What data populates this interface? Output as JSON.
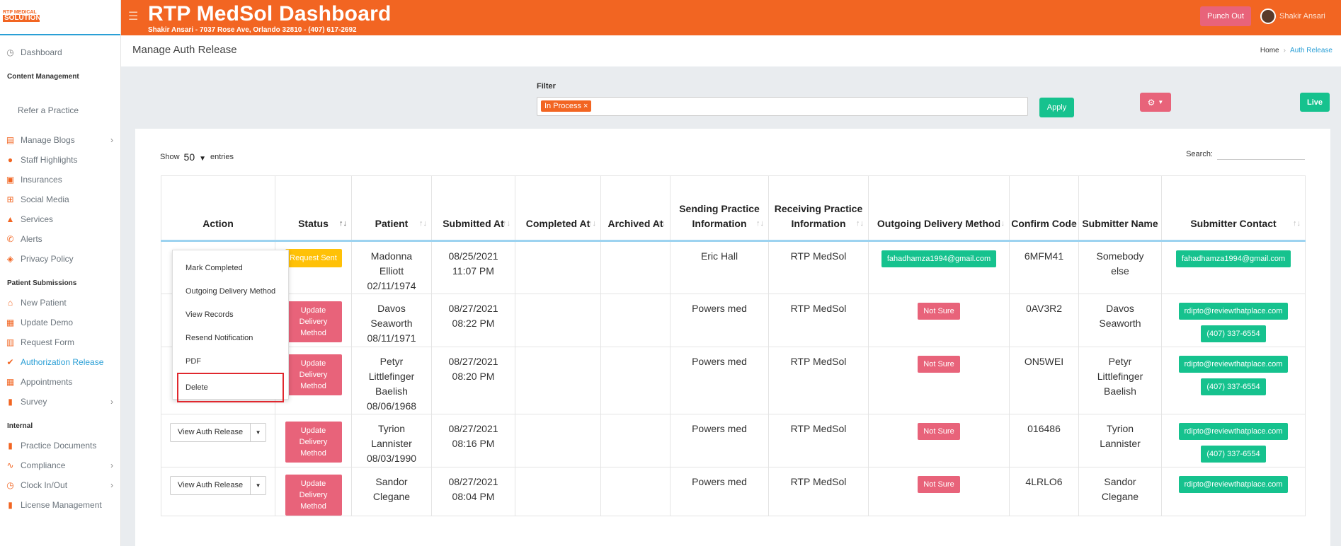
{
  "logo": {
    "top": "RTP MEDICAL",
    "bottom": "SOLUTION"
  },
  "header": {
    "title": "RTP MedSol Dashboard",
    "subtitle": "Shakir Ansari - 7037 Rose Ave, Orlando 32810 - (407) 617-2692",
    "punch_label": "Punch Out",
    "user_name": "Shakir Ansari"
  },
  "sidebar": {
    "dashboard": "Dashboard",
    "content_heading": "Content Management",
    "refer": "Refer a Practice",
    "content_items": [
      {
        "label": "Manage Blogs",
        "icon": "blog-icon",
        "chevron": true
      },
      {
        "label": "Staff Highlights",
        "icon": "user-icon"
      },
      {
        "label": "Insurances",
        "icon": "briefcase-icon"
      },
      {
        "label": "Social Media",
        "icon": "share-icon"
      },
      {
        "label": "Services",
        "icon": "service-icon"
      },
      {
        "label": "Alerts",
        "icon": "phone-icon"
      },
      {
        "label": "Privacy Policy",
        "icon": "shield-icon"
      }
    ],
    "patient_heading": "Patient Submissions",
    "patient_items": [
      {
        "label": "New Patient",
        "icon": "home-icon"
      },
      {
        "label": "Update Demo",
        "icon": "table-icon"
      },
      {
        "label": "Request Form",
        "icon": "form-icon"
      },
      {
        "label": "Authorization Release",
        "icon": "check-icon",
        "active": true
      },
      {
        "label": "Appointments",
        "icon": "calendar-icon"
      },
      {
        "label": "Survey",
        "icon": "chart-icon",
        "chevron": true
      }
    ],
    "internal_heading": "Internal",
    "internal_items": [
      {
        "label": "Practice Documents",
        "icon": "document-icon"
      },
      {
        "label": "Compliance",
        "icon": "wave-icon",
        "chevron": true
      },
      {
        "label": "Clock In/Out",
        "icon": "clock-icon",
        "chevron": true
      },
      {
        "label": "License Management",
        "icon": "license-icon"
      }
    ]
  },
  "page": {
    "title": "Manage Auth Release",
    "breadcrumb_home": "Home",
    "breadcrumb_current": "Auth Release"
  },
  "filter": {
    "label": "Filter",
    "tag": "In Process ×",
    "apply": "Apply",
    "live": "Live"
  },
  "table_controls": {
    "show": "Show",
    "entries_value": "50",
    "entries": "entries",
    "search": "Search:"
  },
  "columns": [
    "Action",
    "Status",
    "Patient",
    "Submitted At",
    "Completed At",
    "Archived At",
    "Sending Practice Information",
    "Receiving Practice Information",
    "Outgoing Delivery Method",
    "Confirm Code",
    "Submitter Name",
    "Submitter Contact"
  ],
  "rows": [
    {
      "action": "",
      "status": "Request Sent",
      "status_color": "#ffc107",
      "patient": "Madonna Elliott 02/11/1974",
      "submitted": "08/25/2021 11:07 PM",
      "sending": "Eric Hall",
      "receiving": "RTP MedSol",
      "outgoing": "fahadhamza1994@gmail.com",
      "outgoing_color": "#16c28e",
      "code": "6MFM41",
      "submitter": "Somebody else",
      "email": "fahadhamza1994@gmail.com",
      "phone": ""
    },
    {
      "action": "",
      "status": "Update Delivery Method",
      "status_color": "#e8637a",
      "patient": "Davos Seaworth 08/11/1971",
      "submitted": "08/27/2021 08:22 PM",
      "sending": "Powers med",
      "receiving": "RTP MedSol",
      "outgoing": "Not Sure",
      "outgoing_color": "#e8637a",
      "code": "0AV3R2",
      "submitter": "Davos Seaworth",
      "email": "rdipto@reviewthatplace.com",
      "phone": "(407) 337-6554"
    },
    {
      "action": "",
      "status": "Update Delivery Method",
      "status_color": "#e8637a",
      "patient": "Petyr Littlefinger Baelish 08/06/1968",
      "submitted": "08/27/2021 08:20 PM",
      "sending": "Powers med",
      "receiving": "RTP MedSol",
      "outgoing": "Not Sure",
      "outgoing_color": "#e8637a",
      "code": "ON5WEI",
      "submitter": "Petyr Littlefinger Baelish",
      "email": "rdipto@reviewthatplace.com",
      "phone": "(407) 337-6554"
    },
    {
      "action": "View Auth Release",
      "status": "Update Delivery Method",
      "status_color": "#e8637a",
      "patient": "Tyrion Lannister 08/03/1990",
      "submitted": "08/27/2021 08:16 PM",
      "sending": "Powers med",
      "receiving": "RTP MedSol",
      "outgoing": "Not Sure",
      "outgoing_color": "#e8637a",
      "code": "016486",
      "submitter": "Tyrion Lannister",
      "email": "rdipto@reviewthatplace.com",
      "phone": "(407) 337-6554"
    },
    {
      "action": "View Auth Release",
      "status": "Update Delivery Method",
      "status_color": "#e8637a",
      "patient": "Sandor Clegane",
      "submitted": "08/27/2021 08:04 PM",
      "sending": "Powers med",
      "receiving": "RTP MedSol",
      "outgoing": "Not Sure",
      "outgoing_color": "#e8637a",
      "code": "4LRLO6",
      "submitter": "Sandor Clegane",
      "email": "rdipto@reviewthatplace.com",
      "phone": ""
    }
  ],
  "dropdown": {
    "items": [
      "Mark Completed",
      "Outgoing Delivery Method",
      "View Records",
      "Resend Notification",
      "PDF"
    ],
    "delete": "Delete"
  }
}
